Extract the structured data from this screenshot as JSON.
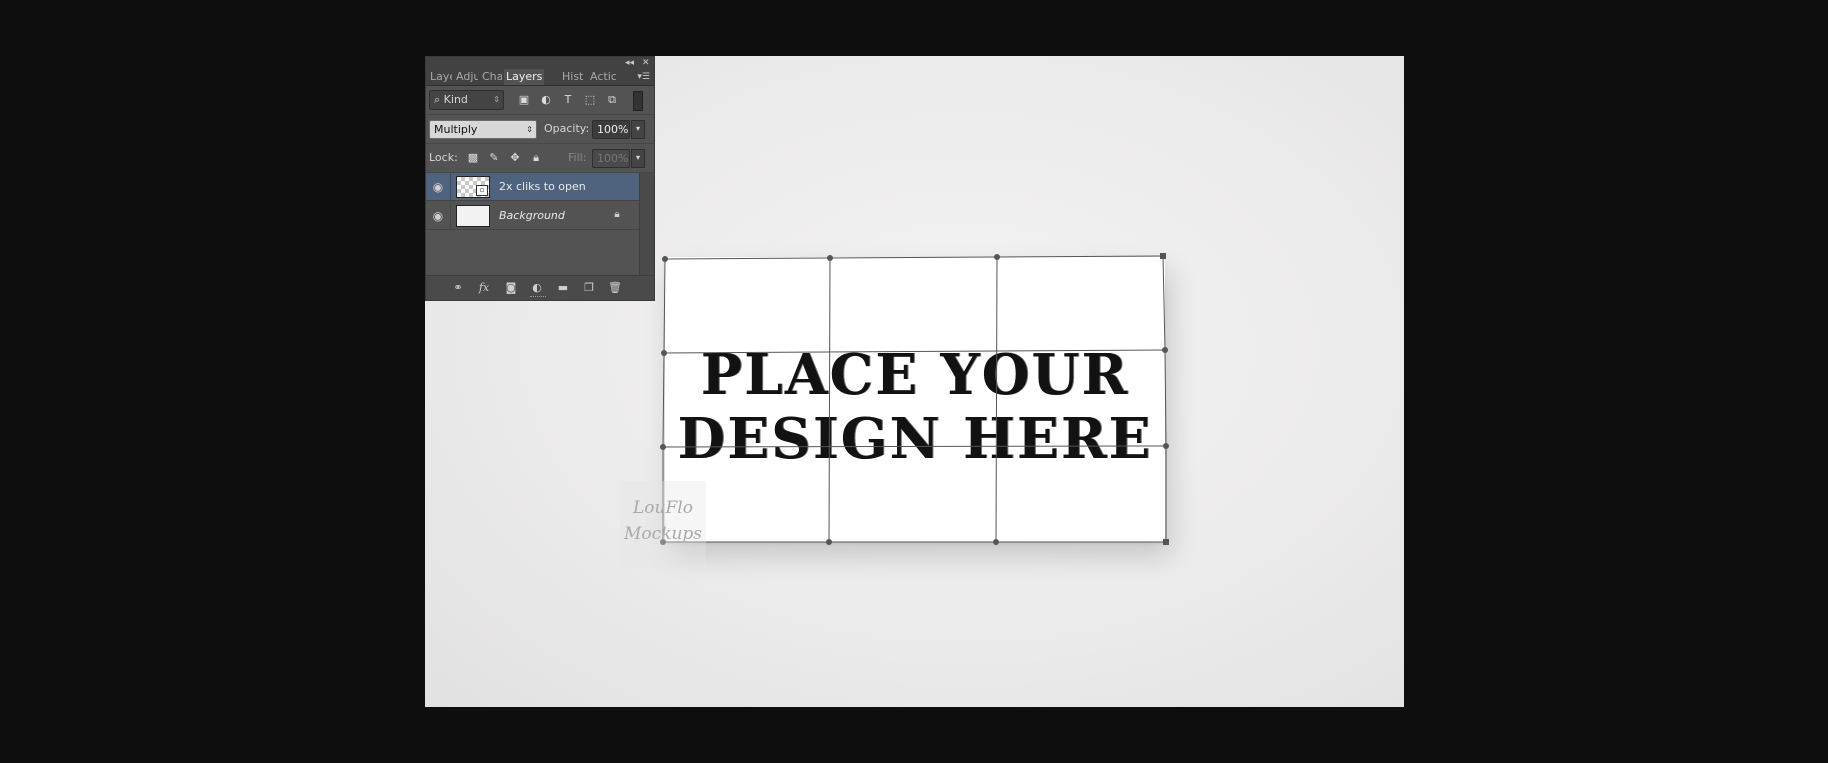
{
  "panel": {
    "tabs": [
      "Laye",
      "Adju",
      "Cha",
      "Layers",
      "Hist",
      "Actic"
    ],
    "active_tab": "Layers",
    "filter_kind": "Kind",
    "blend_mode": "Multiply",
    "opacity_label": "Opacity:",
    "opacity_value": "100%",
    "lock_label": "Lock:",
    "fill_label": "Fill:",
    "fill_value": "100%",
    "layers": [
      {
        "name": "2x cliks to open",
        "selected": true
      },
      {
        "name": "Background",
        "selected": false,
        "locked": true
      }
    ],
    "bottom_fx": "fx"
  },
  "canvas": {
    "card_line1": "PLACE YOUR",
    "card_line2": "DESIGN HERE",
    "watermark_line1": "LouFlo",
    "watermark_line2": "Mockups"
  }
}
